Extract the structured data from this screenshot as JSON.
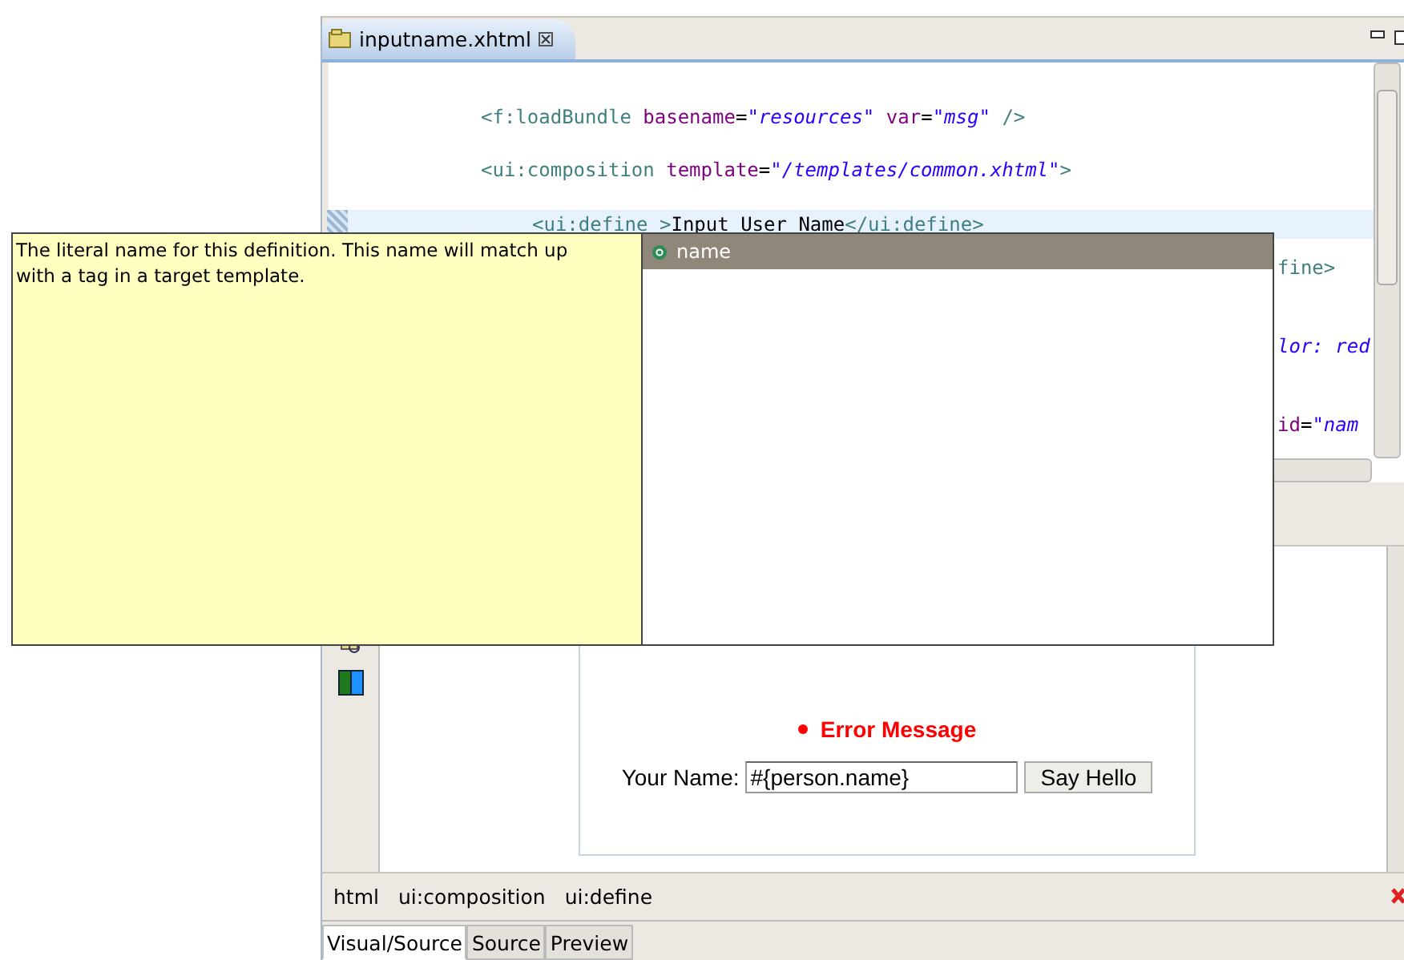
{
  "editor_tab": {
    "title": "inputname.xhtml"
  },
  "code_lines": [
    {
      "text": "<f:loadBundle basename=\"resources\" var=\"msg\" />",
      "current": false
    },
    {
      "text": "<ui:composition template=\"/templates/common.xhtml\">",
      "current": false,
      "children": [
        {
          "text": "<ui:define >Input User Name</ui:define>",
          "current": true
        }
      ]
    }
  ],
  "line_fragments": [
    {
      "kind": "tag",
      "text": "fine>"
    },
    {
      "kind": "value",
      "text": "lor: red"
    },
    {
      "kind": "markup",
      "text": "id=\"nam"
    }
  ],
  "popup": {
    "description": "The literal name for this definition. This name will match up\n with a tag in a target template.",
    "proposals": [
      {
        "label": "name",
        "selected": true
      }
    ]
  },
  "visual": {
    "error_message": "Error Message",
    "field_label": "Your Name:",
    "field_value": "#{person.name}",
    "button": "Say Hello"
  },
  "breadcrumb": [
    "html",
    "ui:composition",
    "ui:define"
  ],
  "bottom_tabs": [
    {
      "label": "Visual/Source",
      "selected": true
    },
    {
      "label": "Source",
      "selected": false
    },
    {
      "label": "Preview",
      "selected": false
    }
  ]
}
